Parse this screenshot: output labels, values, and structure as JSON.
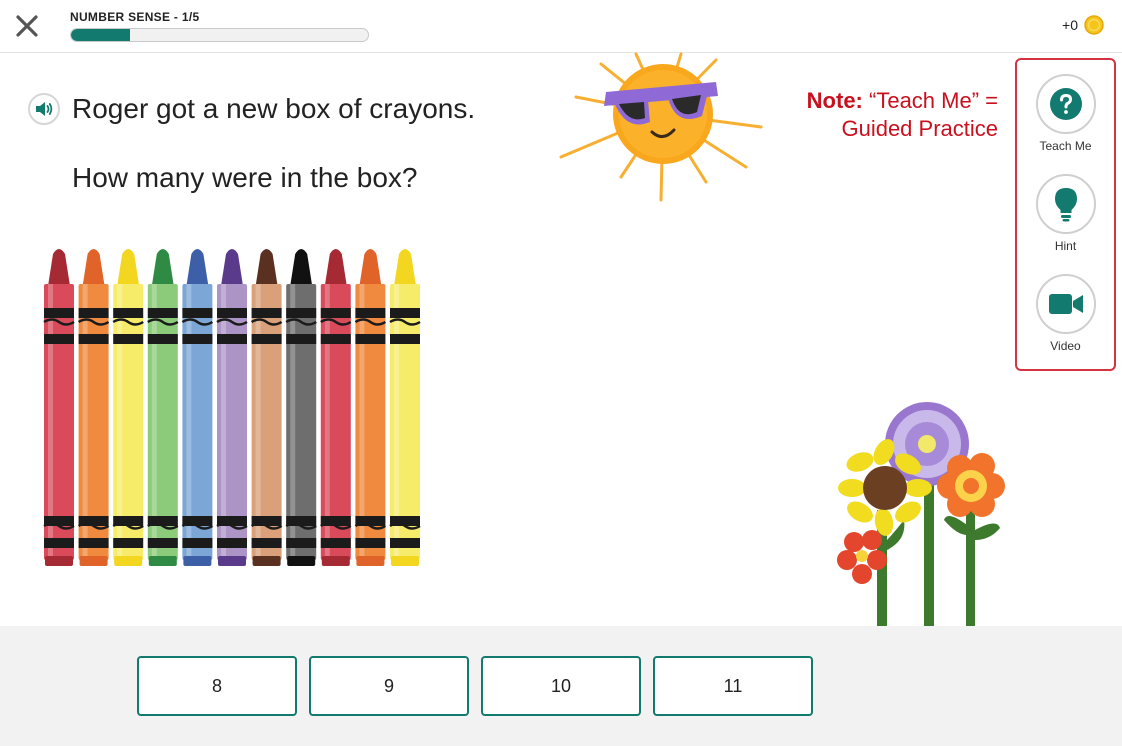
{
  "header": {
    "progress_label": "NUMBER SENSE - 1/5",
    "progress_fraction": 0.2,
    "coins_value": "+0"
  },
  "question": {
    "line1": "Roger got a new box of crayons.",
    "line2": "How many were in the box?"
  },
  "note": {
    "label": "Note:",
    "text": " “Teach Me” = Guided Practice"
  },
  "help": {
    "items": [
      {
        "label": "Teach Me",
        "icon": "question-icon"
      },
      {
        "label": "Hint",
        "icon": "lightbulb-icon"
      },
      {
        "label": "Video",
        "icon": "video-camera-icon"
      }
    ]
  },
  "answers": [
    "8",
    "9",
    "10",
    "11"
  ],
  "crayons": {
    "count": 11,
    "colors": [
      "#d94a5a",
      "#ef8a3e",
      "#f7ec6a",
      "#8ccb7a",
      "#7ba6d6",
      "#ad94c6",
      "#d9a07a",
      "#6e6e6e",
      "#d94a5a",
      "#ef8a3e",
      "#f7ec6a"
    ],
    "tip_colors": [
      "#a52a34",
      "#e0632a",
      "#f2d61f",
      "#2f8a44",
      "#3d5fa8",
      "#5a3a8a",
      "#5a3120",
      "#111111",
      "#a52a34",
      "#e0632a",
      "#f2d61f"
    ]
  },
  "colors": {
    "accent": "#127a6e",
    "note_red": "#c8101e",
    "panel_border": "#d63340",
    "coin": "#f5c518"
  }
}
